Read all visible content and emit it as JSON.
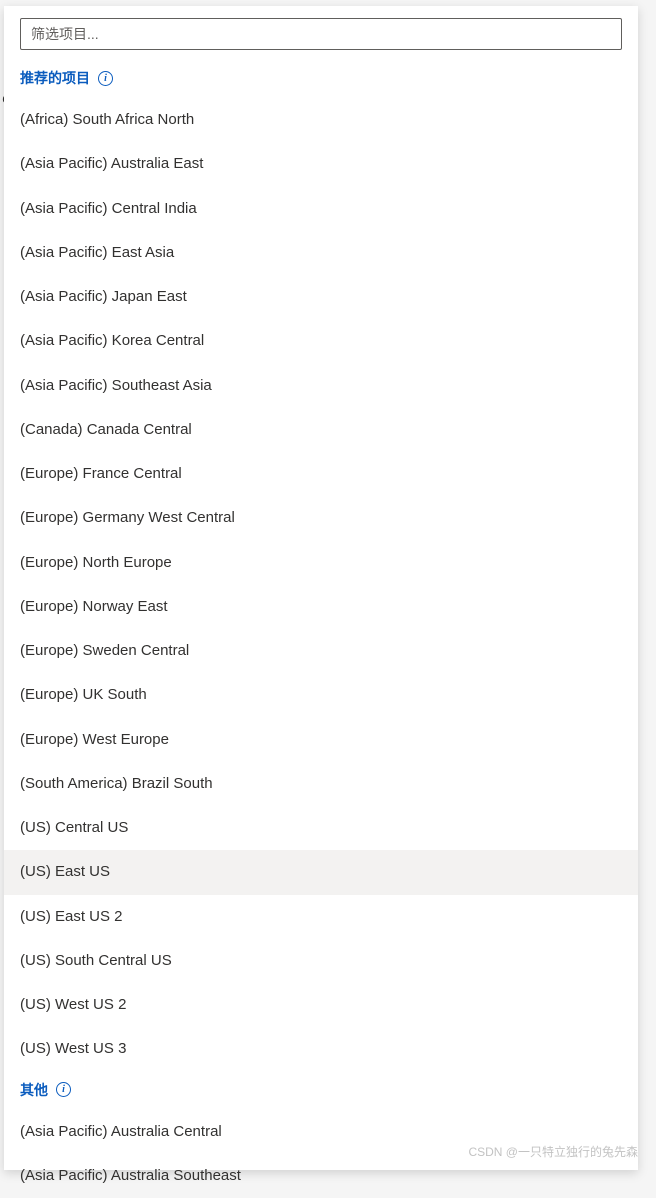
{
  "filter": {
    "placeholder": "筛选项目..."
  },
  "sections": {
    "recommended": {
      "title": "推荐的项目",
      "items": [
        "(Africa) South Africa North",
        "(Asia Pacific) Australia East",
        "(Asia Pacific) Central India",
        "(Asia Pacific) East Asia",
        "(Asia Pacific) Japan East",
        "(Asia Pacific) Korea Central",
        "(Asia Pacific) Southeast Asia",
        "(Canada) Canada Central",
        "(Europe) France Central",
        "(Europe) Germany West Central",
        "(Europe) North Europe",
        "(Europe) Norway East",
        "(Europe) Sweden Central",
        "(Europe) UK South",
        "(Europe) West Europe",
        "(South America) Brazil South",
        "(US) Central US",
        "(US) East US",
        "(US) East US 2",
        "(US) South Central US",
        "(US) West US 2",
        "(US) West US 3"
      ],
      "hovered_index": 17
    },
    "other": {
      "title": "其他",
      "items": [
        "(Asia Pacific) Australia Central",
        "(Asia Pacific) Australia Southeast"
      ]
    }
  },
  "watermark": "CSDN @一只特立独行的兔先森"
}
